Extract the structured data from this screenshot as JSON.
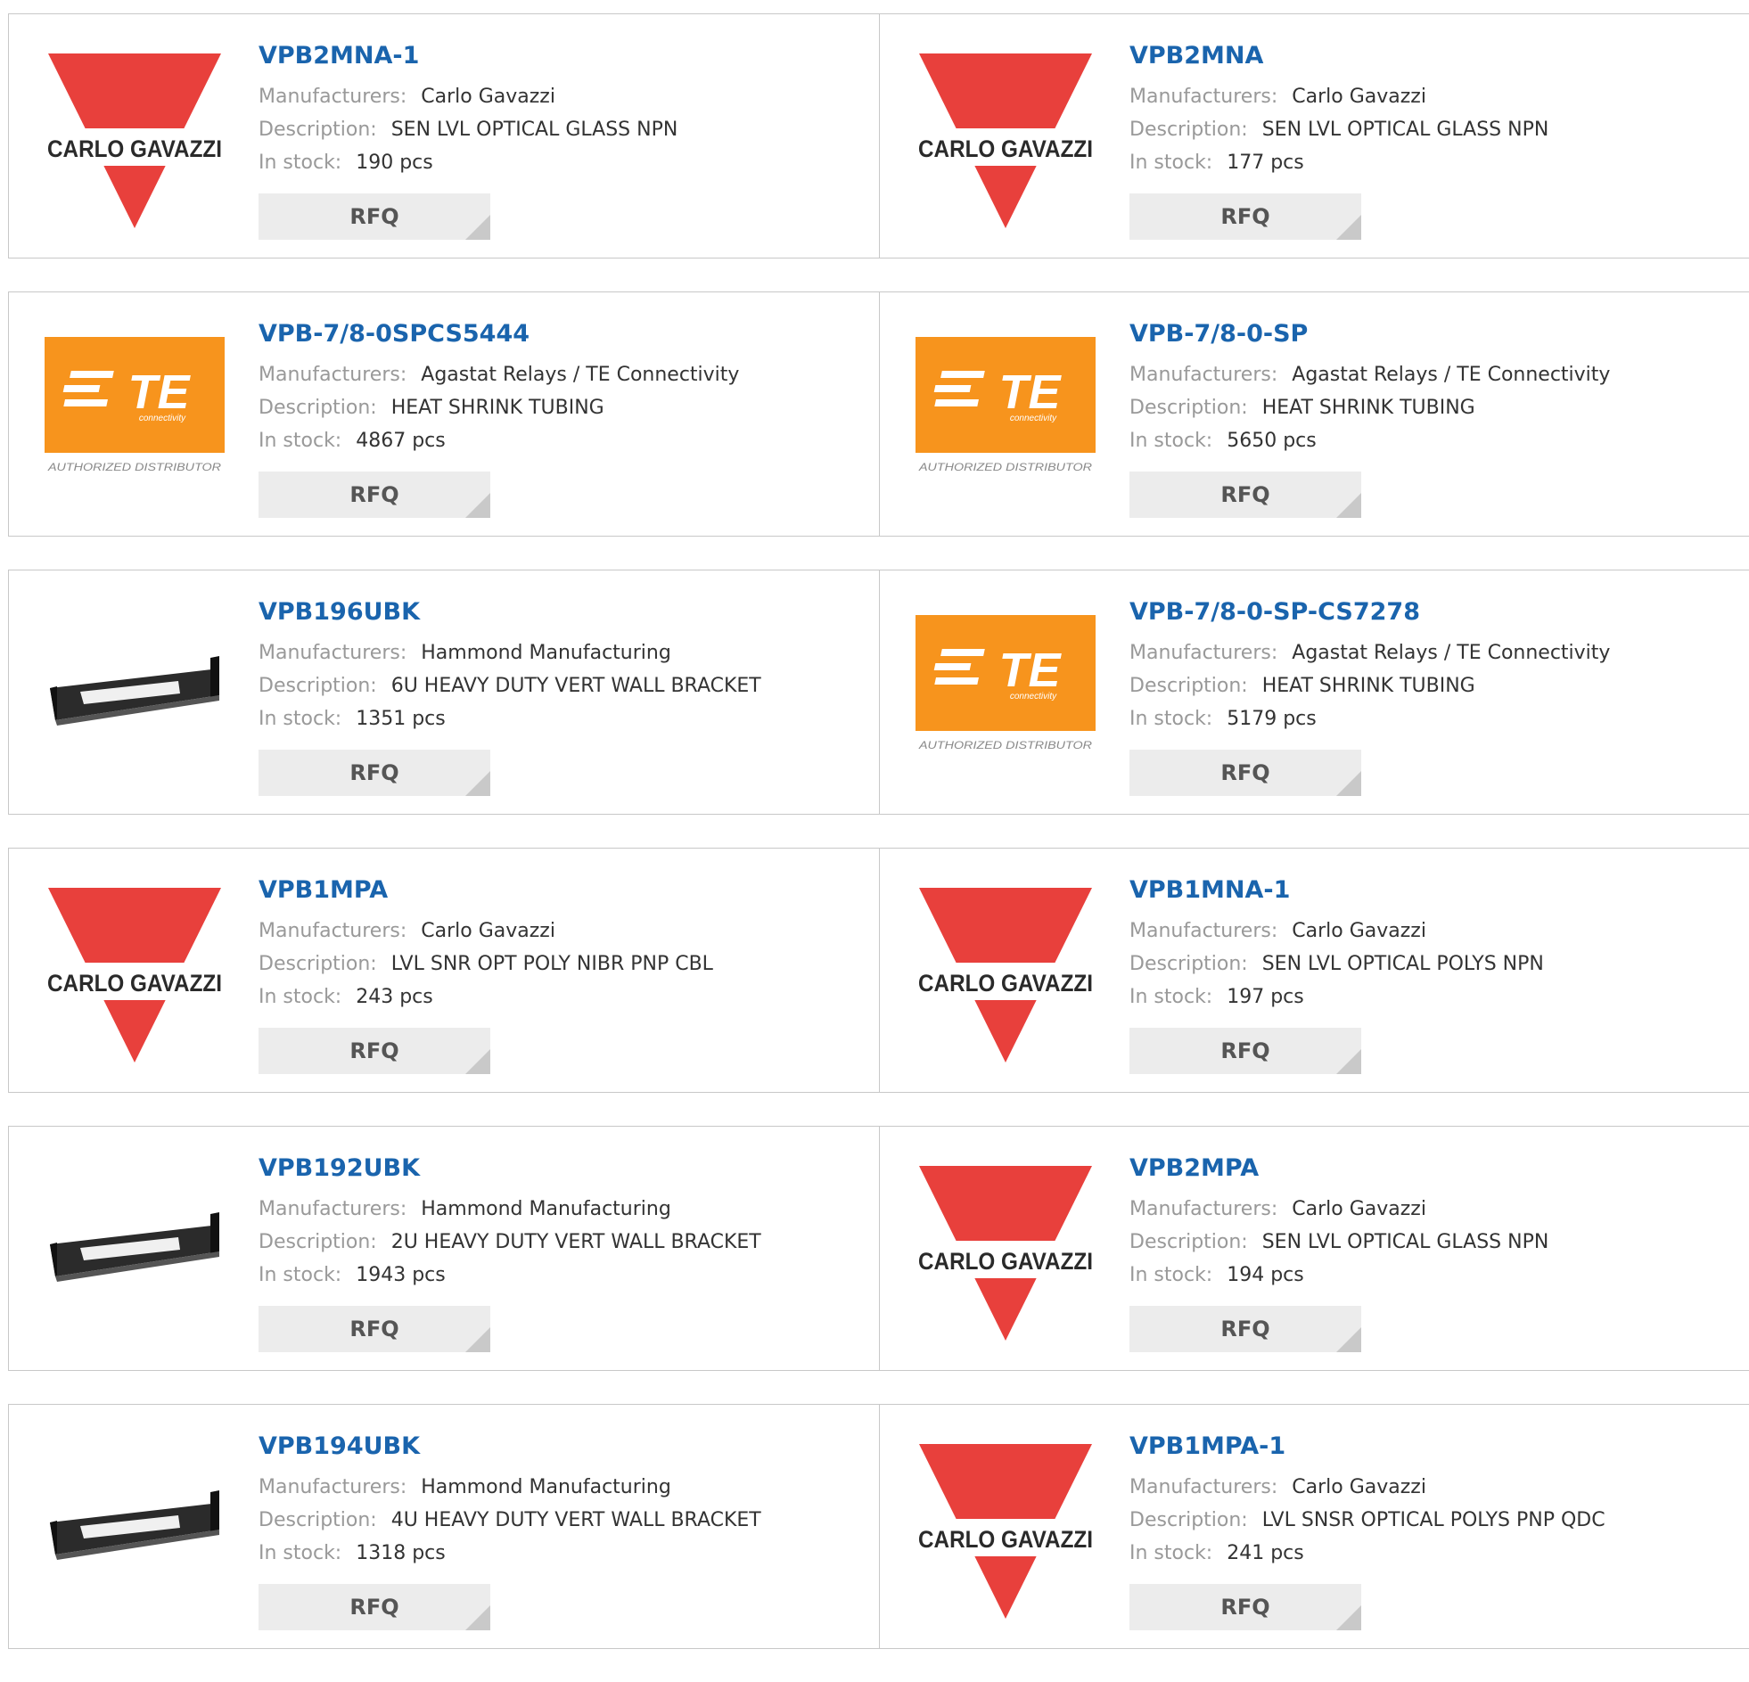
{
  "labels": {
    "manufacturers": "Manufacturers:",
    "description": "Description:",
    "in_stock": "In stock:",
    "rfq": "RFQ"
  },
  "logos": {
    "carlo_gavazzi": {
      "text": "CARLO GAVAZZI",
      "color": "#e8403c"
    },
    "te": {
      "text": "TE",
      "sub": "connectivity",
      "tagline": "AUTHORIZED DISTRIBUTOR",
      "color": "#f7941d"
    },
    "bracket": {
      "color": "#2b2b2b"
    }
  },
  "products": [
    {
      "part": "VPB2MNA-1",
      "manufacturer": "Carlo Gavazzi",
      "description": "SEN LVL OPTICAL GLASS NPN",
      "stock": "190 pcs",
      "logo": "carlo_gavazzi"
    },
    {
      "part": "VPB2MNA",
      "manufacturer": "Carlo Gavazzi",
      "description": "SEN LVL OPTICAL GLASS NPN",
      "stock": "177 pcs",
      "logo": "carlo_gavazzi"
    },
    {
      "part": "VPB-7/8-0SPCS5444",
      "manufacturer": "Agastat Relays / TE Connectivity",
      "description": "HEAT SHRINK TUBING",
      "stock": "4867 pcs",
      "logo": "te"
    },
    {
      "part": "VPB-7/8-0-SP",
      "manufacturer": "Agastat Relays / TE Connectivity",
      "description": "HEAT SHRINK TUBING",
      "stock": "5650 pcs",
      "logo": "te"
    },
    {
      "part": "VPB196UBK",
      "manufacturer": "Hammond Manufacturing",
      "description": "6U HEAVY DUTY VERT WALL BRACKET",
      "stock": "1351 pcs",
      "logo": "bracket"
    },
    {
      "part": "VPB-7/8-0-SP-CS7278",
      "manufacturer": "Agastat Relays / TE Connectivity",
      "description": "HEAT SHRINK TUBING",
      "stock": "5179 pcs",
      "logo": "te"
    },
    {
      "part": "VPB1MPA",
      "manufacturer": "Carlo Gavazzi",
      "description": "LVL SNR OPT POLY NIBR PNP CBL",
      "stock": "243 pcs",
      "logo": "carlo_gavazzi"
    },
    {
      "part": "VPB1MNA-1",
      "manufacturer": "Carlo Gavazzi",
      "description": "SEN LVL OPTICAL POLYS NPN",
      "stock": "197 pcs",
      "logo": "carlo_gavazzi"
    },
    {
      "part": "VPB192UBK",
      "manufacturer": "Hammond Manufacturing",
      "description": "2U HEAVY DUTY VERT WALL BRACKET",
      "stock": "1943 pcs",
      "logo": "bracket"
    },
    {
      "part": "VPB2MPA",
      "manufacturer": "Carlo Gavazzi",
      "description": "SEN LVL OPTICAL GLASS NPN",
      "stock": "194 pcs",
      "logo": "carlo_gavazzi"
    },
    {
      "part": "VPB194UBK",
      "manufacturer": "Hammond Manufacturing",
      "description": "4U HEAVY DUTY VERT WALL BRACKET",
      "stock": "1318 pcs",
      "logo": "bracket"
    },
    {
      "part": "VPB1MPA-1",
      "manufacturer": "Carlo Gavazzi",
      "description": "LVL SNSR OPTICAL POLYS PNP QDC",
      "stock": "241 pcs",
      "logo": "carlo_gavazzi"
    }
  ]
}
